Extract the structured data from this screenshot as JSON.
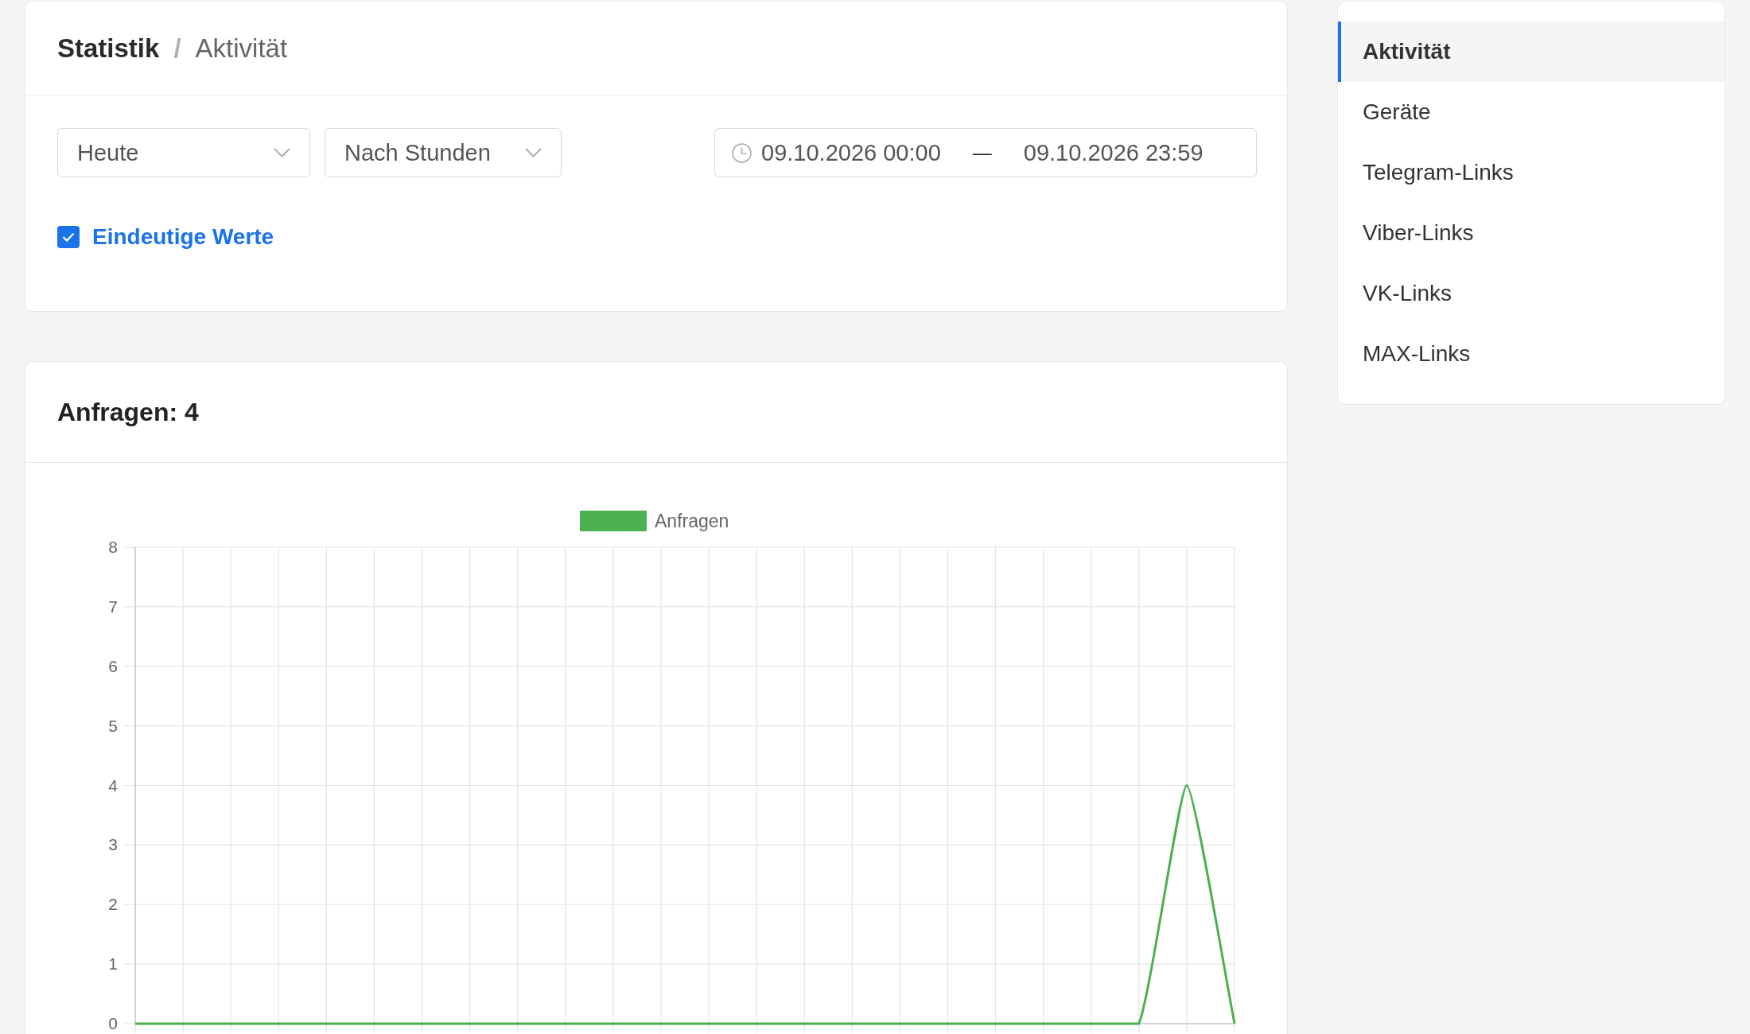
{
  "breadcrumb": {
    "title": "Statistik",
    "separator": "/",
    "current": "Aktivität"
  },
  "filters": {
    "selects": [
      {
        "value": "Heute"
      },
      {
        "value": "Nach Stunden"
      }
    ],
    "date_range": {
      "start": "09.10.2026 00:00",
      "separator": "—",
      "end": "09.10.2026 23:59"
    },
    "unique_values": {
      "label": "Eindeutige Werte",
      "checked": true
    }
  },
  "requests_card": {
    "title": "Anfragen: 4",
    "chart_data": {
      "type": "line",
      "series": [
        {
          "name": "Anfragen",
          "color": "#4caf50",
          "values": [
            0,
            0,
            0,
            0,
            0,
            0,
            0,
            0,
            0,
            0,
            0,
            0,
            0,
            0,
            0,
            0,
            0,
            0,
            0,
            0,
            0,
            0,
            4,
            0
          ]
        }
      ],
      "ylim": [
        0,
        8
      ],
      "yticks": [
        0,
        1,
        2,
        3,
        4,
        5,
        6,
        7,
        8
      ],
      "grid": true
    }
  },
  "sidebar": {
    "items": [
      {
        "label": "Aktivität",
        "selected": true
      },
      {
        "label": "Geräte",
        "selected": false
      },
      {
        "label": "Telegram-Links",
        "selected": false
      },
      {
        "label": "Viber-Links",
        "selected": false
      },
      {
        "label": "VK-Links",
        "selected": false
      },
      {
        "label": "MAX-Links",
        "selected": false
      }
    ]
  }
}
